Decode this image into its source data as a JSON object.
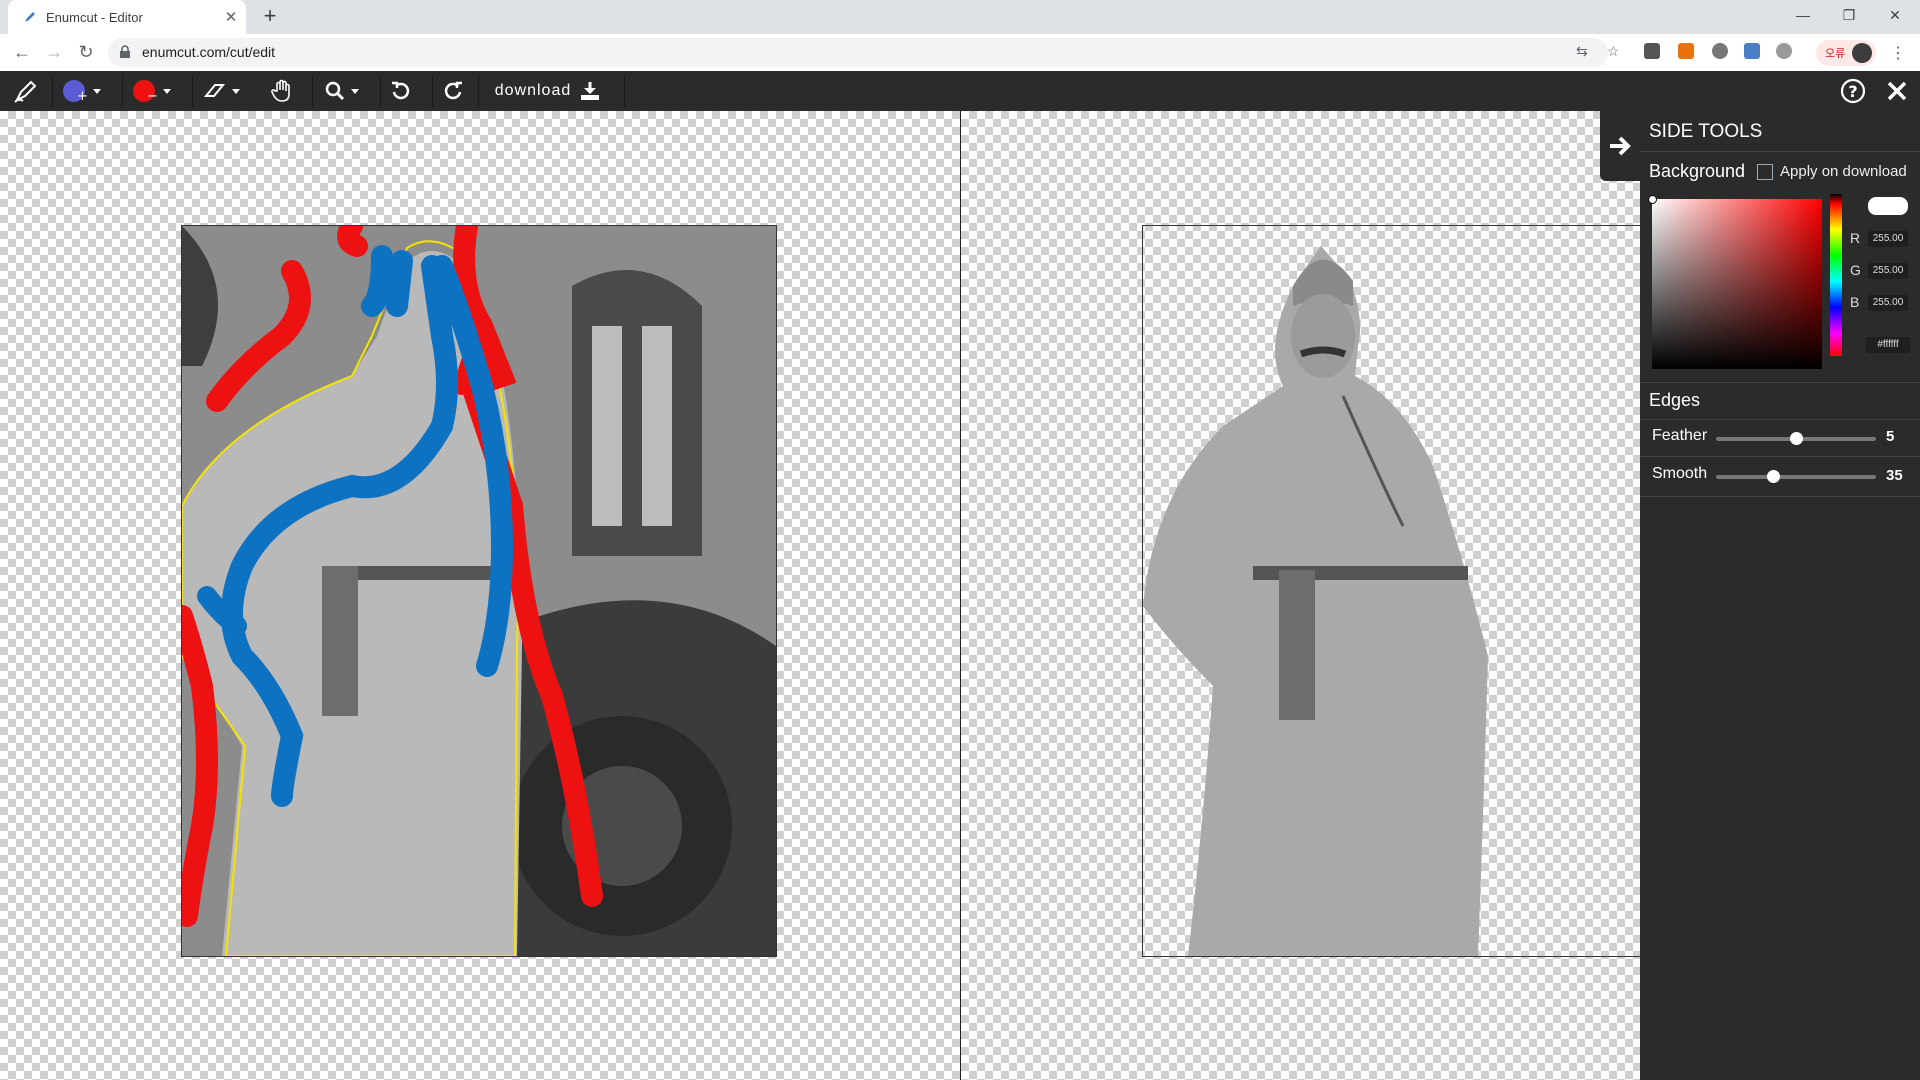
{
  "browser": {
    "tab_title": "Enumcut - Editor",
    "url": "enumcut.com/cut/edit",
    "profile_label": "오류"
  },
  "toolbar": {
    "download_label": "download",
    "foreground_brush_color": "#5b5bd6",
    "background_brush_color": "#ee1111"
  },
  "side_panel": {
    "title": "SIDE TOOLS",
    "background_label": "Background",
    "apply_on_download_label": "Apply on download",
    "apply_on_download_checked": false,
    "color": {
      "r_label": "R",
      "r": "255.00",
      "g_label": "G",
      "g": "255.00",
      "b_label": "B",
      "b": "255.00",
      "hex": "#ffffff"
    },
    "edges_label": "Edges",
    "feather_label": "Feather",
    "feather_value": "5",
    "feather_fraction": 0.5,
    "smooth_label": "Smooth",
    "smooth_value": "35",
    "smooth_fraction": 0.35
  }
}
